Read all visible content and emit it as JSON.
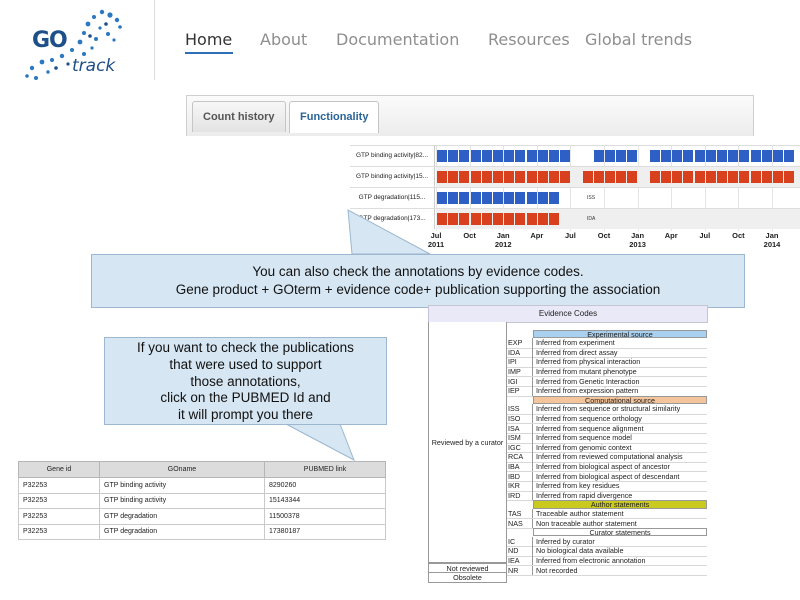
{
  "logo": {
    "go": "GO",
    "track": "track"
  },
  "nav": {
    "items": [
      "Home",
      "About",
      "Documentation",
      "Resources",
      "Global trends"
    ],
    "active": "Home"
  },
  "tabs": [
    {
      "label": "Count history"
    },
    {
      "label": "Functionality",
      "active": true
    }
  ],
  "colors": {
    "blue": "#2e5fc4",
    "red": "#d9401e",
    "callout": "#d6e6f3",
    "accent": "#2f6fb8"
  },
  "timeline": {
    "rows": [
      {
        "label": "GTP binding activity|82...",
        "color": "blue",
        "tag": ""
      },
      {
        "label": "GTP binding activity|15...",
        "color": "red",
        "tag": ""
      },
      {
        "label": "GTP degradation|115...",
        "color": "blue",
        "tag": "ISS"
      },
      {
        "label": "GTP degradation|173...",
        "color": "red",
        "tag": "IDA"
      }
    ],
    "ticks": [
      {
        "month": "Jul",
        "year": "2011"
      },
      {
        "month": "Oct",
        "year": ""
      },
      {
        "month": "Jan",
        "year": "2012"
      },
      {
        "month": "Apr",
        "year": ""
      },
      {
        "month": "Jul",
        "year": ""
      },
      {
        "month": "Oct",
        "year": ""
      },
      {
        "month": "Jan",
        "year": "2013"
      },
      {
        "month": "Apr",
        "year": ""
      },
      {
        "month": "Jul",
        "year": ""
      },
      {
        "month": "Oct",
        "year": ""
      },
      {
        "month": "Jan",
        "year": "2014"
      }
    ]
  },
  "callout_main": {
    "line1": "You can also check the annotations by evidence codes.",
    "line2": "Gene product + GOterm + evidence code+ publication supporting the association"
  },
  "callout_pubmed": {
    "lines": [
      "If you want to check the publications",
      "that were used to support",
      "those annotations,",
      "click on the PUBMED Id and",
      "it will prompt you there"
    ]
  },
  "gene_table": {
    "headers": [
      "Gene id",
      "GOname",
      "PUBMED link"
    ],
    "rows": [
      [
        "P32253",
        "GTP binding activity",
        "8290260"
      ],
      [
        "P32253",
        "GTP binding activity",
        "15143344"
      ],
      [
        "P32253",
        "GTP degradation",
        "11500378"
      ],
      [
        "P32253",
        "GTP degradation",
        "17380187"
      ]
    ]
  },
  "evidence": {
    "title": "Evidence Codes",
    "groups": {
      "reviewed": "Reviewed by a curator",
      "not_reviewed": "Not reviewed",
      "obsolete": "Obsolete"
    },
    "sections": [
      {
        "name": "Experimental source",
        "color": "#a9d0ee",
        "codes": [
          [
            "EXP",
            "Inferred from experiment"
          ],
          [
            "IDA",
            "Inferred from direct assay"
          ],
          [
            "IPI",
            "Inferred from physical interaction"
          ],
          [
            "IMP",
            "Inferred from mutant phenotype"
          ],
          [
            "IGI",
            "Inferred from Genetic Interaction"
          ],
          [
            "IEP",
            "Inferred from expression pattern"
          ]
        ]
      },
      {
        "name": "Computational source",
        "color": "#f4c49a",
        "codes": [
          [
            "ISS",
            "Inferred from sequence or structural similarity"
          ],
          [
            "ISO",
            "Inferred from sequence orthology"
          ],
          [
            "ISA",
            "Inferred from sequence alignment"
          ],
          [
            "ISM",
            "Inferred from sequence model"
          ],
          [
            "IGC",
            "Inferred from genomic context"
          ],
          [
            "RCA",
            "Inferred from reviewed computational analysis"
          ],
          [
            "IBA",
            "Inferred from biological aspect of ancestor"
          ],
          [
            "IBD",
            "Inferred from biological aspect of descendant"
          ],
          [
            "IKR",
            "Inferred from key residues"
          ],
          [
            "IRD",
            "Inferred from rapid divergence"
          ]
        ]
      },
      {
        "name": "Author statements",
        "color": "#c9c920",
        "codes": [
          [
            "TAS",
            "Traceable author statement"
          ],
          [
            "NAS",
            "Non traceable author statement"
          ]
        ]
      },
      {
        "name": "Curator statements",
        "color": "#ffffff",
        "codes": [
          [
            "IC",
            "Inferred by curator"
          ],
          [
            "ND",
            "No biological data available"
          ]
        ]
      }
    ],
    "not_reviewed_code": [
      "IEA",
      "Inferred from electronic annotation"
    ],
    "obsolete_code": [
      "NR",
      "Not recorded"
    ]
  }
}
